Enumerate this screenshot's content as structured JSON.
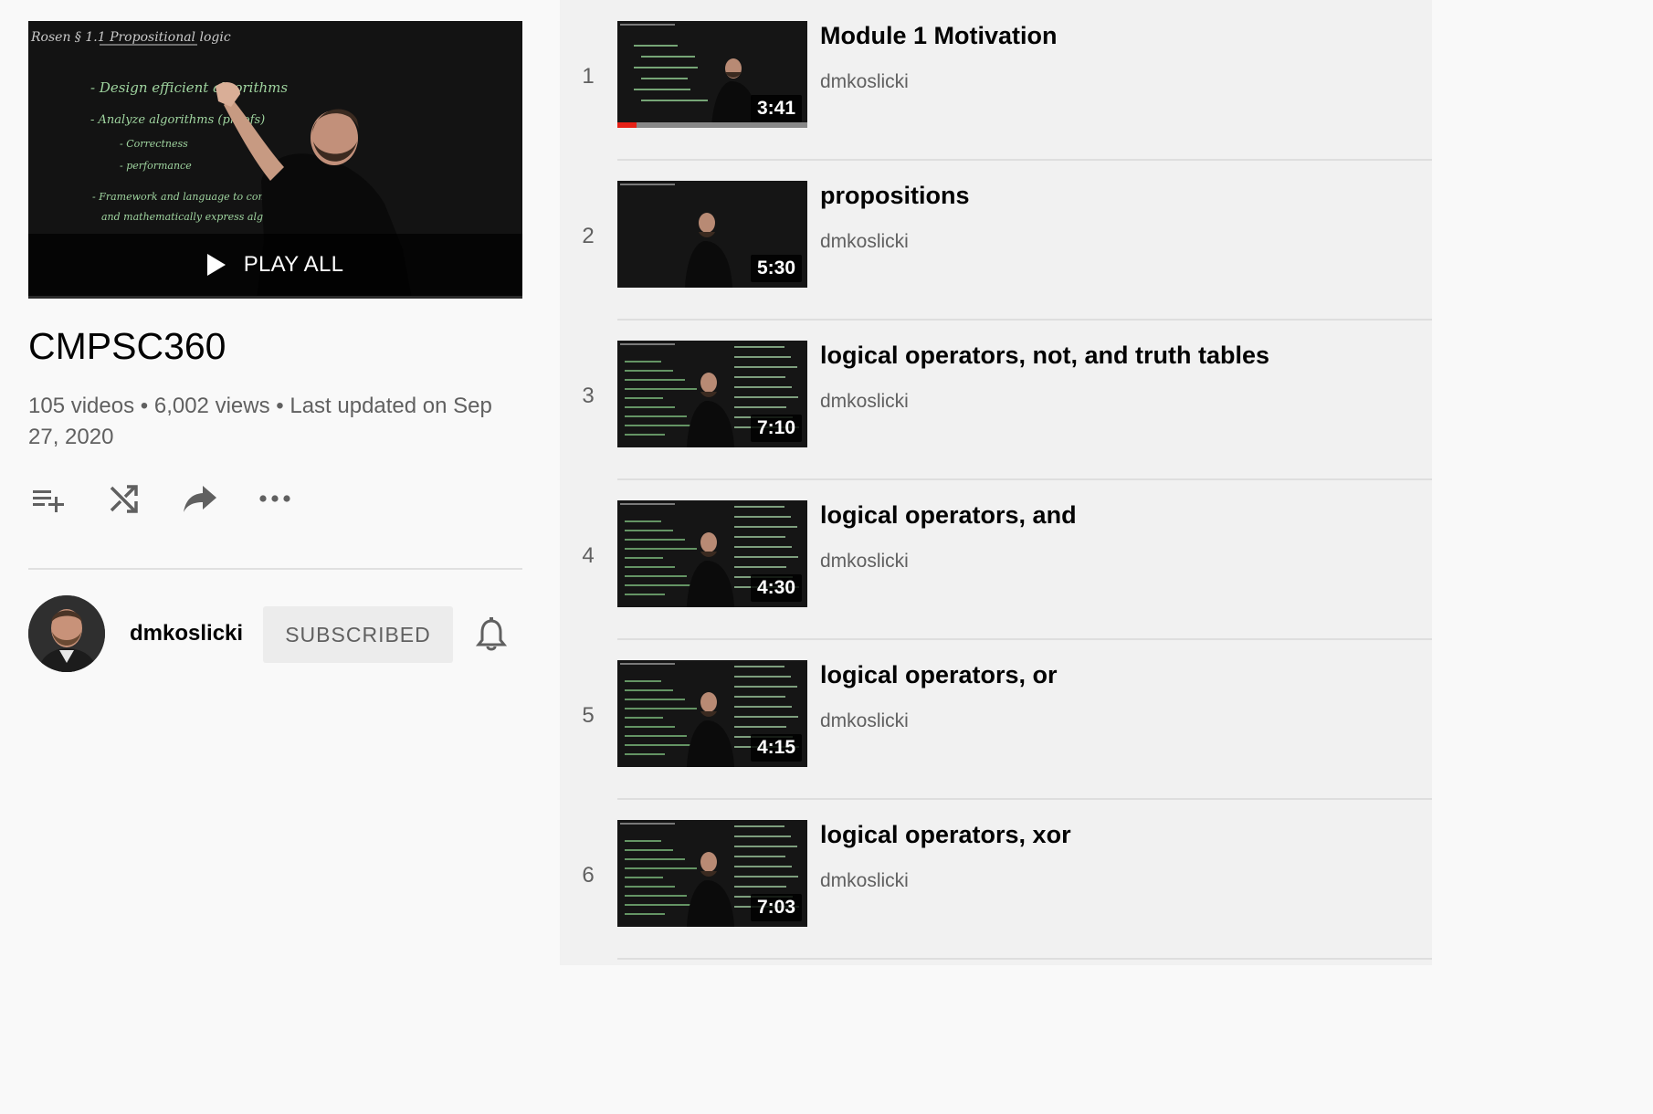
{
  "playlist": {
    "play_all_label": "PLAY ALL",
    "title": "CMPSC360",
    "video_count": "105 videos",
    "views": "6,002 views",
    "updated": "Last updated on Sep 27, 2020",
    "meta_separator": " • ",
    "hero_board_text": [
      "Rosen § 1.1 Propositional logic",
      "- Design efficient algorithms",
      "- Analyze algorithms (proofs)",
      "- Correctness",
      "- performance",
      "- Framework and language to compactly",
      "and mathematically express algorithms"
    ]
  },
  "actions": [
    {
      "name": "save-to-queue",
      "icon": "playlist-add-icon"
    },
    {
      "name": "shuffle",
      "icon": "shuffle-icon"
    },
    {
      "name": "share",
      "icon": "share-icon"
    },
    {
      "name": "more",
      "icon": "more-horizontal-icon"
    }
  ],
  "owner": {
    "name": "dmkoslicki",
    "subscribe_label": "SUBSCRIBED",
    "bell_icon": "bell-icon"
  },
  "videos": [
    {
      "index": "1",
      "title": "Module 1 Motivation",
      "channel": "dmkoslicki",
      "duration": "3:41",
      "watched_progress": 0.1
    },
    {
      "index": "2",
      "title": "propositions",
      "channel": "dmkoslicki",
      "duration": "5:30"
    },
    {
      "index": "3",
      "title": "logical operators, not, and truth tables",
      "channel": "dmkoslicki",
      "duration": "7:10"
    },
    {
      "index": "4",
      "title": "logical operators, and",
      "channel": "dmkoslicki",
      "duration": "4:30"
    },
    {
      "index": "5",
      "title": "logical operators, or",
      "channel": "dmkoslicki",
      "duration": "4:15"
    },
    {
      "index": "6",
      "title": "logical operators, xor",
      "channel": "dmkoslicki",
      "duration": "7:03"
    }
  ],
  "colors": {
    "progress_red": "#e62117",
    "chalk_green": "#8fc98f",
    "sidebar_bg": "#f9f9f9",
    "list_bg": "#f1f1f1"
  }
}
